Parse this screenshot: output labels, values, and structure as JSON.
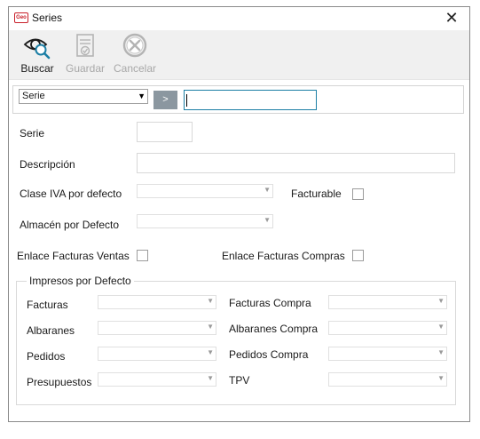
{
  "window": {
    "app_icon_text": "Geo",
    "title": "Series",
    "close_glyph": "✕"
  },
  "toolbar": {
    "buttons": [
      {
        "label": "Buscar",
        "icon": "search-eye-icon",
        "enabled": true
      },
      {
        "label": "Guardar",
        "icon": "save-document-icon",
        "enabled": false
      },
      {
        "label": "Cancelar",
        "icon": "cancel-x-icon",
        "enabled": false
      }
    ]
  },
  "search": {
    "field_selected": "Serie",
    "go_glyph": ">",
    "query": ""
  },
  "form": {
    "serie_label": "Serie",
    "serie_value": "",
    "descripcion_label": "Descripción",
    "descripcion_value": "",
    "clase_iva_label": "Clase IVA por defecto",
    "clase_iva_value": "",
    "facturable_label": "Facturable",
    "facturable_checked": false,
    "almacen_label": "Almacén por Defecto",
    "almacen_value": "",
    "enlace_ventas_label": "Enlace Facturas Ventas",
    "enlace_ventas_checked": false,
    "enlace_compras_label": "Enlace Facturas Compras",
    "enlace_compras_checked": false
  },
  "impresos": {
    "title": "Impresos por Defecto",
    "left": [
      {
        "label": "Facturas",
        "value": ""
      },
      {
        "label": "Albaranes",
        "value": ""
      },
      {
        "label": "Pedidos",
        "value": ""
      },
      {
        "label": "Presupuestos",
        "value": ""
      }
    ],
    "right": [
      {
        "label": "Facturas Compra",
        "value": ""
      },
      {
        "label": "Albaranes Compra",
        "value": ""
      },
      {
        "label": "Pedidos Compra",
        "value": ""
      },
      {
        "label": "TPV",
        "value": ""
      }
    ]
  },
  "colors": {
    "search_focus_border": "#1b7ea5",
    "go_button": "#8b97a0",
    "icon_teal": "#1b7ea5",
    "disabled_text": "#a8a8a8"
  }
}
